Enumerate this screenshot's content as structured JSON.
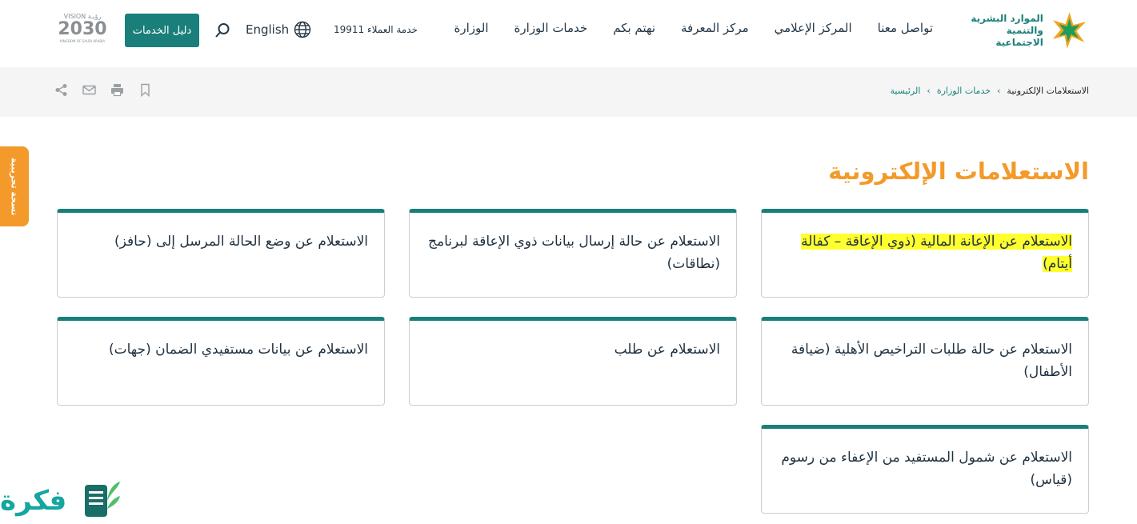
{
  "header": {
    "logo_line1": "الموارد البشرية",
    "logo_line2": "والتنمية الاجتماعية",
    "nav": [
      "الوزارة",
      "خدمات الوزارة",
      "نهتم بكم",
      "مركز المعرفة",
      "المركز الإعلامي",
      "تواصل معنا"
    ],
    "customer_service": "خدمة العملاء 19911",
    "language": "English",
    "services_button": "دليل الخدمات",
    "vision_top": "VISION رؤيـة",
    "vision_year": "2030",
    "vision_country": "KINGDOM OF SAUDI ARABIA"
  },
  "breadcrumb": {
    "home": "الرئيسية",
    "section": "خدمات الوزارة",
    "current": "الاستعلامات الإلكترونية"
  },
  "side_tab": "نسخة تجريبية",
  "page_title": "الاستعلامات الإلكترونية",
  "cards": [
    "الاستعلام عن الإعانة المالية (ذوي الإعاقة – كفالة أيتام)",
    "الاستعلام عن حالة إرسال بيانات ذوي الإعاقة لبرنامج (نطاقات)",
    "الاستعلام عن وضع الحالة المرسل إلى (حافز)",
    "الاستعلام عن حالة طلبات التراخيص الأهلية (ضيافة الأطفال)",
    "الاستعلام عن طلب",
    "الاستعلام عن بيانات مستفيدي الضمان (جهات)",
    "الاستعلام عن شمول المستفيد من الإعفاء من رسوم (قياس)"
  ],
  "watermark": "فكرة",
  "colors": {
    "teal": "#1a7f7a",
    "orange": "#f39a2a",
    "highlight": "#ffff2e"
  },
  "icons": [
    "search-icon",
    "globe-icon",
    "bookmark-icon",
    "print-icon",
    "mail-icon",
    "share-icon",
    "chevron-left-icon"
  ]
}
